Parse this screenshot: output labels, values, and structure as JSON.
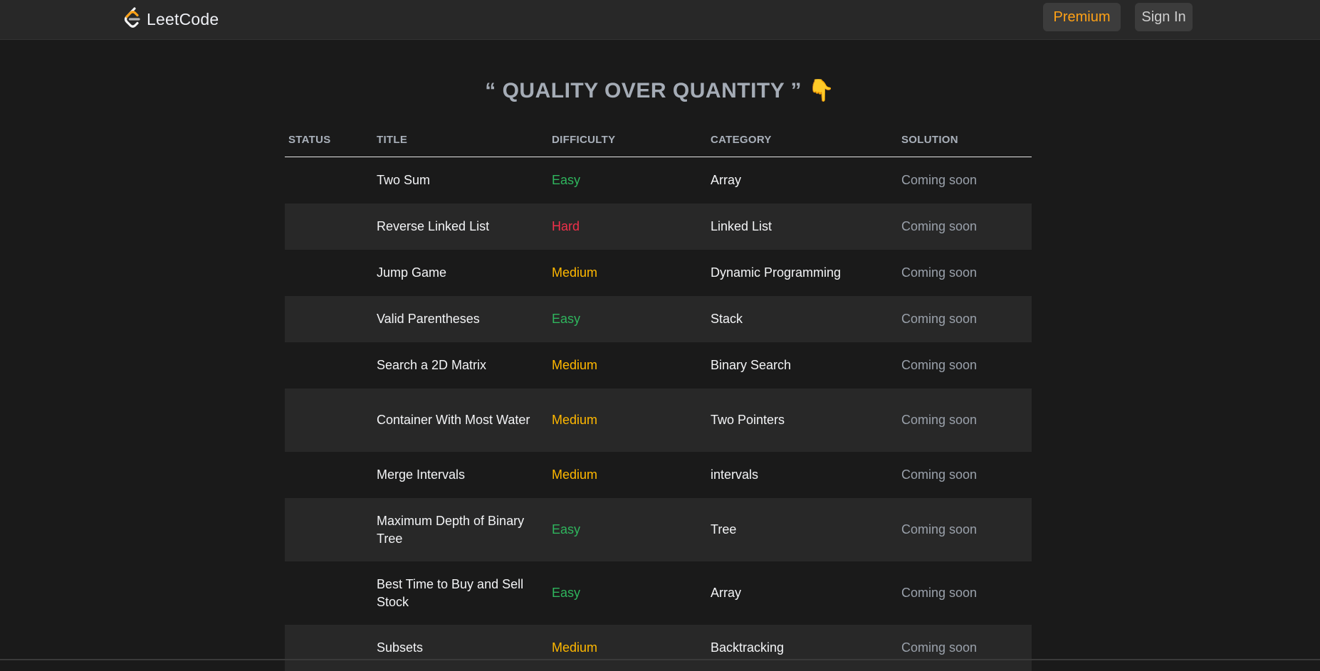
{
  "nav": {
    "logo_text": "LeetCode",
    "premium_label": "Premium",
    "signin_label": "Sign In"
  },
  "headline": {
    "text": "“ QUALITY OVER QUANTITY ”",
    "emoji": "👇"
  },
  "table": {
    "headers": {
      "status": "STATUS",
      "title": "TITLE",
      "difficulty": "DIFFICULTY",
      "category": "CATEGORY",
      "solution": "SOLUTION"
    },
    "rows": [
      {
        "title": "Two Sum",
        "difficulty": "Easy",
        "category": "Array",
        "solution": "Coming soon"
      },
      {
        "title": "Reverse Linked List",
        "difficulty": "Hard",
        "category": "Linked List",
        "solution": "Coming soon"
      },
      {
        "title": "Jump Game",
        "difficulty": "Medium",
        "category": "Dynamic Programming",
        "solution": "Coming soon"
      },
      {
        "title": "Valid Parentheses",
        "difficulty": "Easy",
        "category": "Stack",
        "solution": "Coming soon"
      },
      {
        "title": "Search a 2D Matrix",
        "difficulty": "Medium",
        "category": "Binary Search",
        "solution": "Coming soon"
      },
      {
        "title": "Container With Most Water",
        "difficulty": "Medium",
        "category": "Two Pointers",
        "solution": "Coming soon"
      },
      {
        "title": "Merge Intervals",
        "difficulty": "Medium",
        "category": "intervals",
        "solution": "Coming soon"
      },
      {
        "title": "Maximum Depth of Binary Tree",
        "difficulty": "Easy",
        "category": "Tree",
        "solution": "Coming soon"
      },
      {
        "title": "Best Time to Buy and Sell Stock",
        "difficulty": "Easy",
        "category": "Array",
        "solution": "Coming soon"
      },
      {
        "title": "Subsets",
        "difficulty": "Medium",
        "category": "Backtracking",
        "solution": "Coming soon"
      }
    ]
  },
  "colors": {
    "background": "#1a1a1a",
    "navbar": "#282828",
    "premium": "#ffa116",
    "easy": "#2fb55d",
    "medium": "#ffb800",
    "hard": "#f0304a"
  },
  "icons": {
    "logo": "leetcode-logo-icon"
  }
}
